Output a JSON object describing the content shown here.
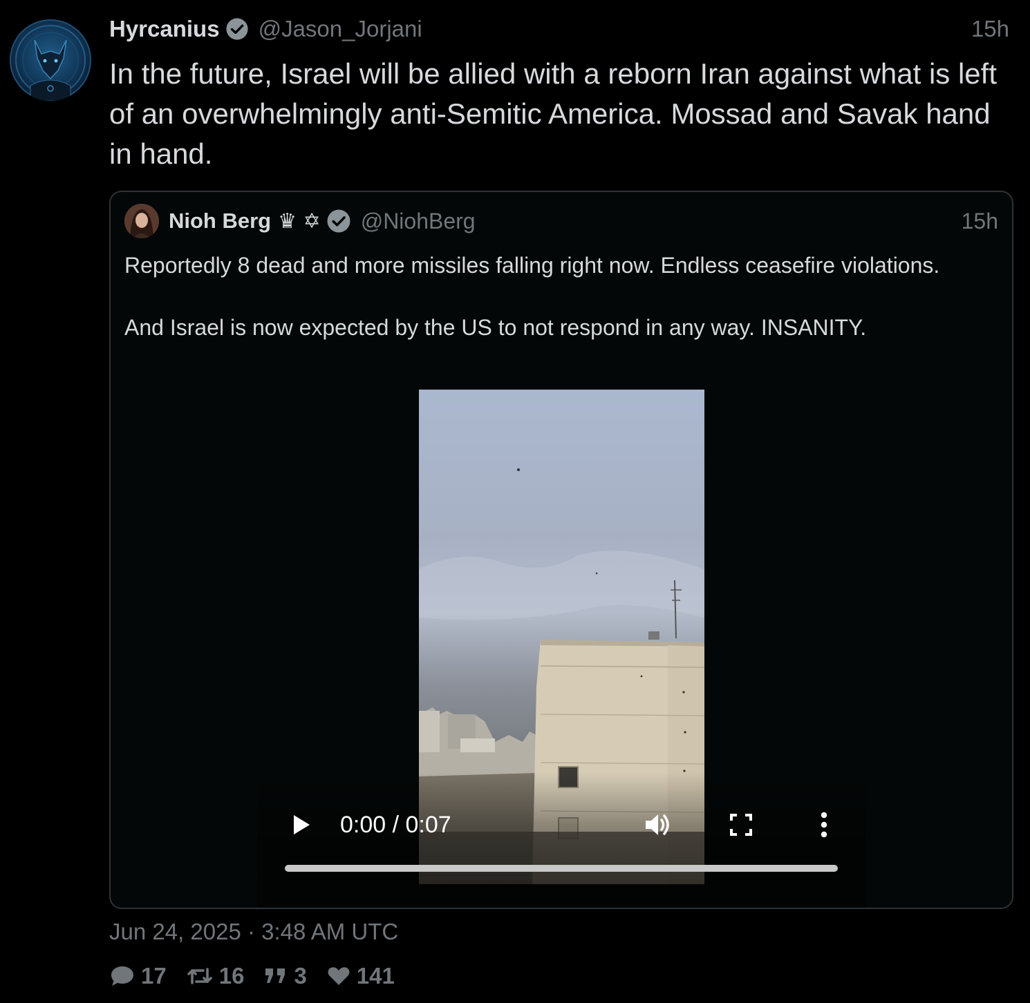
{
  "tweet": {
    "author_name": "Hyrcanius",
    "author_handle": "@Jason_Jorjani",
    "time": "15h",
    "text": "In the future, Israel will be allied with a reborn Iran against what is left of an overwhelmingly anti-Semitic America. Mossad and Savak hand in hand.",
    "date": "Jun 24, 2025 · 3:48 AM UTC"
  },
  "quote": {
    "author_name": "Nioh Berg",
    "author_emoji": "♛ ✡",
    "author_handle": "@NiohBerg",
    "time": "15h",
    "paragraph_1": "Reportedly 8 dead and more missiles falling right now. Endless ceasefire violations.",
    "paragraph_2": "And Israel is now expected by the US to not respond in any way. INSANITY."
  },
  "video": {
    "time_display": "0:00 / 0:07",
    "progress_fraction": 0
  },
  "stats": {
    "replies": "17",
    "retweets": "16",
    "quotes": "3",
    "likes": "141"
  },
  "icons": {
    "verified": "verified-badge-icon",
    "play": "play-icon",
    "volume": "volume-icon",
    "fullscreen": "fullscreen-icon",
    "more": "more-vertical-icon",
    "reply": "comment-icon",
    "retweet": "retweet-icon",
    "quote": "quote-icon",
    "like": "heart-icon"
  },
  "colors": {
    "background": "#000000",
    "text": "#d7dadc",
    "muted": "#71767b",
    "border": "#2f3336",
    "verified_badge": "#8a9499"
  }
}
